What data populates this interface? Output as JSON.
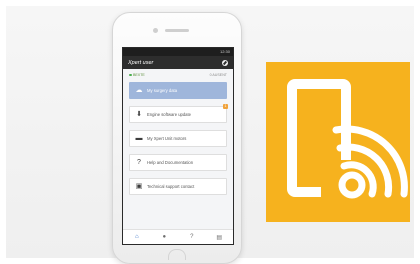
{
  "app": {
    "title": "Xpert user",
    "status_time": "12:30"
  },
  "meta": {
    "left": "BEXTE",
    "right": "0 AUSENT"
  },
  "menu": [
    {
      "label": "My surgery data",
      "icon": "cloud-icon",
      "active": true
    },
    {
      "label": "Engine software update",
      "icon": "download-icon",
      "badge": "1"
    },
    {
      "label": "My Xpert Unit motors",
      "icon": "motor-icon"
    },
    {
      "label": "Help and Documentation",
      "icon": "help-icon"
    },
    {
      "label": "Technical support contact",
      "icon": "contact-card-icon"
    }
  ],
  "tabs": [
    {
      "name": "home-tab",
      "icon": "home-icon"
    },
    {
      "name": "user-tab",
      "icon": "user-icon"
    },
    {
      "name": "help-tab",
      "icon": "help-icon"
    },
    {
      "name": "calendar-tab",
      "icon": "calendar-icon"
    }
  ],
  "colors": {
    "tile_bg": "#f6b21e",
    "active_card": "#9fb6db",
    "appbar": "#2d2d2d"
  }
}
